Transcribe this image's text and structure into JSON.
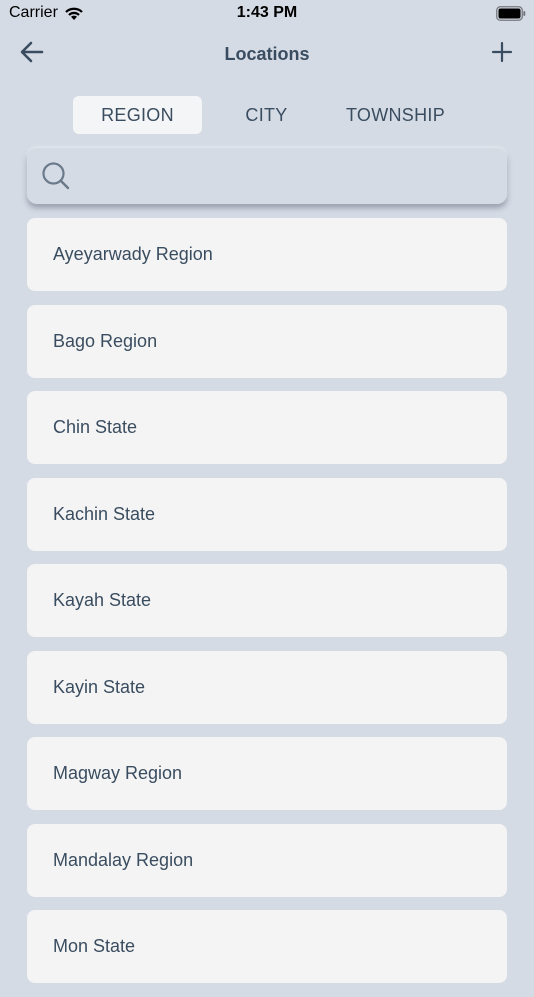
{
  "status_bar": {
    "carrier": "Carrier",
    "time": "1:43 PM",
    "icons": [
      "wifi-icon",
      "battery-icon"
    ]
  },
  "nav": {
    "title": "Locations",
    "back_icon": "arrow-left-icon",
    "add_icon": "plus-icon"
  },
  "tabs": [
    {
      "label": "REGION",
      "active": true
    },
    {
      "label": "CITY",
      "active": false
    },
    {
      "label": "TOWNSHIP",
      "active": false
    }
  ],
  "search": {
    "icon": "search-icon",
    "value": "",
    "placeholder": ""
  },
  "locations": [
    {
      "name": "Ayeyarwady Region"
    },
    {
      "name": "Bago Region"
    },
    {
      "name": "Chin State"
    },
    {
      "name": "Kachin State"
    },
    {
      "name": "Kayah State"
    },
    {
      "name": "Kayin State"
    },
    {
      "name": "Magway Region"
    },
    {
      "name": "Mandalay Region"
    },
    {
      "name": "Mon State"
    }
  ],
  "colors": {
    "background": "#d5dbe5",
    "card": "#f4f4f4",
    "text": "#3a4d60",
    "active_tab": "#f4f5f6"
  }
}
